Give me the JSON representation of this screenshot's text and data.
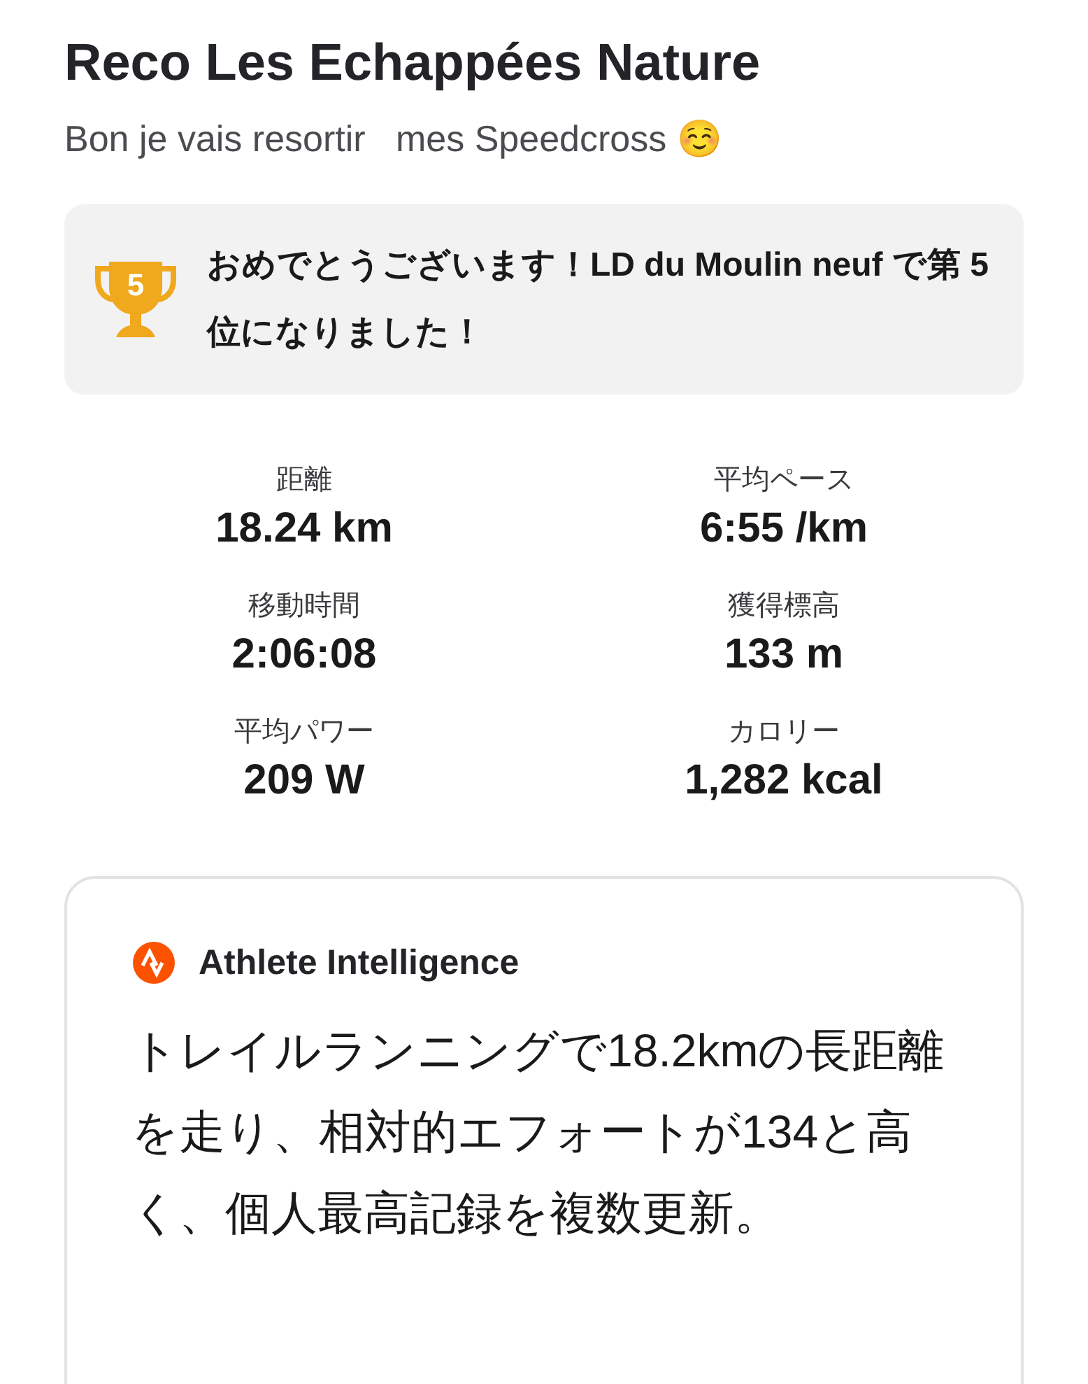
{
  "title": "Reco Les Echappées Nature",
  "description": "Bon je vais resortir   mes Speedcross ☺️",
  "achievement": {
    "rank": "5",
    "message": "おめでとうございます！LD du Moulin neuf で第 5 位になりました！"
  },
  "stats": [
    {
      "label": "距離",
      "value": "18.24 km"
    },
    {
      "label": "平均ペース",
      "value": "6:55 /km"
    },
    {
      "label": "移動時間",
      "value": "2:06:08"
    },
    {
      "label": "獲得標高",
      "value": "133 m"
    },
    {
      "label": "平均パワー",
      "value": "209 W"
    },
    {
      "label": "カロリー",
      "value": "1,282 kcal"
    }
  ],
  "insight": {
    "title": "Athlete Intelligence",
    "text": "トレイルランニングで18.2kmの長距離を走り、相対的エフォートが134と高く、個人最高記録を複数更新。"
  }
}
